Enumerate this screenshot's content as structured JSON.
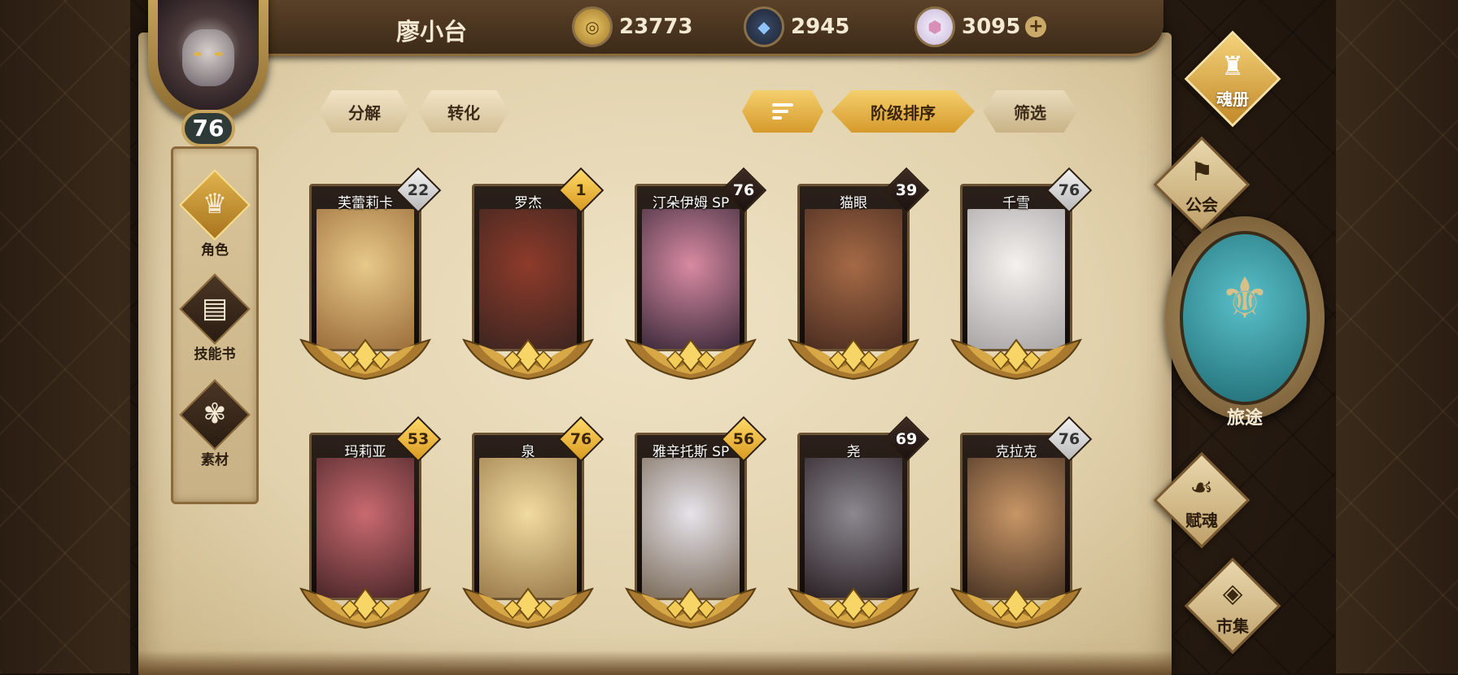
{
  "player": {
    "name": "廖小台",
    "level": "76"
  },
  "resources": [
    {
      "icon": "gold-coin-icon",
      "value": "23773"
    },
    {
      "icon": "blue-crystal-icon",
      "value": "2945"
    },
    {
      "icon": "gem-icon",
      "value": "3095",
      "plus": "+"
    }
  ],
  "toolbar": {
    "decompose": "分解",
    "convert": "转化",
    "sort_order": "阶级排序",
    "filter": "筛选"
  },
  "sidebar": [
    {
      "label": "角色",
      "icon": "character-icon",
      "active": true
    },
    {
      "label": "技能书",
      "icon": "skill-book-icon",
      "active": false
    },
    {
      "label": "素材",
      "icon": "material-icon",
      "active": false
    }
  ],
  "cards": [
    {
      "name": "芙蕾莉卡",
      "level": "22",
      "badge": "silver",
      "art": [
        "#e8c98a",
        "#9b6d3a"
      ]
    },
    {
      "name": "罗杰",
      "level": "1",
      "badge": "gold",
      "art": [
        "#8e3b2a",
        "#3c2520"
      ]
    },
    {
      "name": "汀朵伊姆 SP",
      "level": "76",
      "badge": "dark",
      "art": [
        "#d88aa2",
        "#3b2a3a"
      ]
    },
    {
      "name": "猫眼",
      "level": "39",
      "badge": "dark",
      "art": [
        "#a56a46",
        "#4a2c20"
      ]
    },
    {
      "name": "千雪",
      "level": "76",
      "badge": "silver",
      "art": [
        "#f4f1ee",
        "#a9a4a4"
      ]
    },
    {
      "name": "玛莉亚",
      "level": "53",
      "badge": "gold",
      "art": [
        "#c96a70",
        "#4a2628"
      ]
    },
    {
      "name": "泉",
      "level": "76",
      "badge": "gold",
      "art": [
        "#f1dba0",
        "#9a7a4a"
      ]
    },
    {
      "name": "雅辛托斯 SP",
      "level": "56",
      "badge": "gold",
      "art": [
        "#e6e3ea",
        "#7a6a58"
      ]
    },
    {
      "name": "尧",
      "level": "69",
      "badge": "dark",
      "art": [
        "#8c8890",
        "#2a2024"
      ]
    },
    {
      "name": "克拉克",
      "level": "76",
      "badge": "silver",
      "art": [
        "#c89666",
        "#4a3424"
      ]
    }
  ],
  "right_menu": {
    "soul_book": "魂册",
    "guild": "公会",
    "journey": "旅途",
    "soul_grant": "赋魂",
    "market": "市集"
  }
}
